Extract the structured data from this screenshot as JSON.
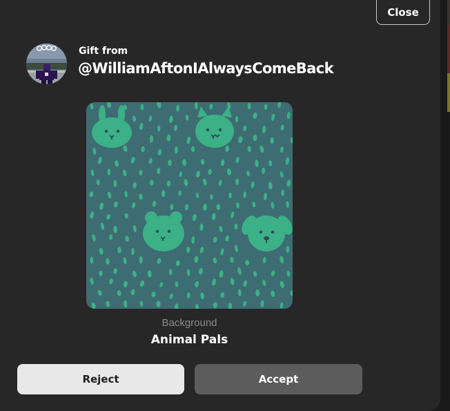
{
  "dialog": {
    "close_label": "Close",
    "gift_from_label": "Gift from",
    "sender_username": "@WilliamAftonIAlwaysComeBack"
  },
  "item": {
    "type_label": "Background",
    "name": "Animal Pals",
    "pattern_icon": "animal-pals-pattern"
  },
  "actions": {
    "reject_label": "Reject",
    "accept_label": "Accept"
  },
  "colors": {
    "dialog_bg": "#272727",
    "pattern_bg": "#3e6c73",
    "pattern_accent": "#3cb086",
    "reject_bg": "#e8e8e8",
    "accept_bg": "#5c5c5c"
  }
}
